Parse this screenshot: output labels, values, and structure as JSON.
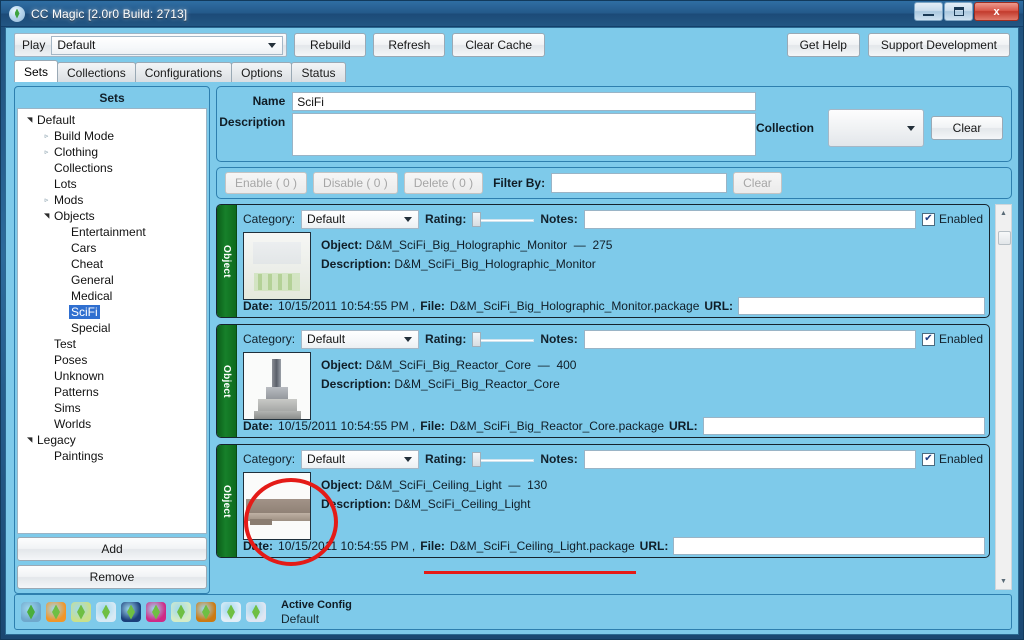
{
  "window": {
    "title": "CC Magic [2.0r0 Build: 2713]",
    "icon": "plumbob-icon",
    "minimize": "–",
    "maximize": "□",
    "close": "x"
  },
  "toolbar": {
    "play_label": "Play",
    "play_value": "Default",
    "rebuild": "Rebuild",
    "refresh": "Refresh",
    "clear_cache": "Clear Cache",
    "get_help": "Get Help",
    "support": "Support Development"
  },
  "tabs": [
    {
      "label": "Sets",
      "active": true
    },
    {
      "label": "Collections",
      "active": false
    },
    {
      "label": "Configurations",
      "active": false
    },
    {
      "label": "Options",
      "active": false
    },
    {
      "label": "Status",
      "active": false
    }
  ],
  "sidebar": {
    "header": "Sets",
    "add_label": "Add",
    "remove_label": "Remove",
    "tree": [
      {
        "label": "Default",
        "indent": 0,
        "expander": "open",
        "selected": false
      },
      {
        "label": "Build Mode",
        "indent": 1,
        "expander": "closed",
        "selected": false
      },
      {
        "label": "Clothing",
        "indent": 1,
        "expander": "closed",
        "selected": false
      },
      {
        "label": "Collections",
        "indent": 1,
        "expander": "none",
        "selected": false
      },
      {
        "label": "Lots",
        "indent": 1,
        "expander": "none",
        "selected": false
      },
      {
        "label": "Mods",
        "indent": 1,
        "expander": "closed",
        "selected": false
      },
      {
        "label": "Objects",
        "indent": 1,
        "expander": "open",
        "selected": false
      },
      {
        "label": "Entertainment",
        "indent": 2,
        "expander": "none",
        "selected": false
      },
      {
        "label": "Cars",
        "indent": 2,
        "expander": "none",
        "selected": false
      },
      {
        "label": "Cheat",
        "indent": 2,
        "expander": "none",
        "selected": false
      },
      {
        "label": "General",
        "indent": 2,
        "expander": "none",
        "selected": false
      },
      {
        "label": "Medical",
        "indent": 2,
        "expander": "none",
        "selected": false
      },
      {
        "label": "SciFi",
        "indent": 2,
        "expander": "none",
        "selected": true
      },
      {
        "label": "Special",
        "indent": 2,
        "expander": "none",
        "selected": false
      },
      {
        "label": "Test",
        "indent": 1,
        "expander": "none",
        "selected": false
      },
      {
        "label": "Poses",
        "indent": 1,
        "expander": "none",
        "selected": false
      },
      {
        "label": "Unknown",
        "indent": 1,
        "expander": "none",
        "selected": false
      },
      {
        "label": "Patterns",
        "indent": 1,
        "expander": "none",
        "selected": false
      },
      {
        "label": "Sims",
        "indent": 1,
        "expander": "none",
        "selected": false
      },
      {
        "label": "Worlds",
        "indent": 1,
        "expander": "none",
        "selected": false
      },
      {
        "label": "Legacy",
        "indent": 0,
        "expander": "open",
        "selected": false
      },
      {
        "label": "Paintings",
        "indent": 1,
        "expander": "none",
        "selected": false
      }
    ]
  },
  "meta": {
    "name_label": "Name",
    "name_value": "SciFi",
    "description_label": "Description",
    "description_value": "",
    "collection_label": "Collection",
    "collection_value": "",
    "clear_label": "Clear"
  },
  "actions": {
    "enable": "Enable ( 0 )",
    "disable": "Disable ( 0 )",
    "delete": "Delete ( 0 )",
    "filter_label": "Filter By:",
    "filter_value": "",
    "clear": "Clear"
  },
  "cards": [
    {
      "tab_label": "Object",
      "category_label": "Category:",
      "category_value": "Default",
      "rating_label": "Rating:",
      "rating_value": 0,
      "notes_label": "Notes:",
      "notes_value": "",
      "enabled_label": "Enabled",
      "enabled": true,
      "object_label": "Object:",
      "object_name": "D&M_SciFi_Big_Holographic_Monitor",
      "object_size": "275",
      "description_label": "Description:",
      "description_value": "D&M_SciFi_Big_Holographic_Monitor",
      "date_label": "Date:",
      "date_value": "10/15/2011 10:54:55 PM ,",
      "file_label": "File:",
      "file_value": "D&M_SciFi_Big_Holographic_Monitor.package",
      "url_label": "URL:",
      "url_value": "",
      "thumb": "holographic-monitor-thumbnail"
    },
    {
      "tab_label": "Object",
      "category_label": "Category:",
      "category_value": "Default",
      "rating_label": "Rating:",
      "rating_value": 0,
      "notes_label": "Notes:",
      "notes_value": "",
      "enabled_label": "Enabled",
      "enabled": true,
      "object_label": "Object:",
      "object_name": "D&M_SciFi_Big_Reactor_Core",
      "object_size": "400",
      "description_label": "Description:",
      "description_value": "D&M_SciFi_Big_Reactor_Core",
      "date_label": "Date:",
      "date_value": "10/15/2011 10:54:55 PM ,",
      "file_label": "File:",
      "file_value": "D&M_SciFi_Big_Reactor_Core.package",
      "url_label": "URL:",
      "url_value": "",
      "thumb": "reactor-core-thumbnail"
    },
    {
      "tab_label": "Object",
      "category_label": "Category:",
      "category_value": "Default",
      "rating_label": "Rating:",
      "rating_value": 0,
      "notes_label": "Notes:",
      "notes_value": "",
      "enabled_label": "Enabled",
      "enabled": true,
      "object_label": "Object:",
      "object_name": "D&M_SciFi_Ceiling_Light",
      "object_size": "130",
      "description_label": "Description:",
      "description_value": "D&M_SciFi_Ceiling_Light",
      "date_label": "Date:",
      "date_value": "10/15/2011 10:54:55 PM ,",
      "file_label": "File:",
      "file_value": "D&M_SciFi_Ceiling_Light.package",
      "url_label": "URL:",
      "url_value": "",
      "thumb": "ceiling-light-thumbnail"
    }
  ],
  "statusbar": {
    "active_config_label": "Active Config",
    "active_config_value": "Default",
    "icons": [
      {
        "name": "plumbob-icon-base-game",
        "bg": "#6fa8cc",
        "gem": "#4bae3c"
      },
      {
        "name": "plumbob-icon-world-adv",
        "bg": "#f0962a",
        "gem": "#6fbf43"
      },
      {
        "name": "plumbob-icon-hi-end-loft",
        "bg": "#c9e08a",
        "gem": "#6fbf43"
      },
      {
        "name": "plumbob-icon-ambitions",
        "bg": "#d7e9f4",
        "gem": "#6fbf43"
      },
      {
        "name": "plumbob-icon-fast-lane",
        "bg": "#1b3f7a",
        "gem": "#6fbf43"
      },
      {
        "name": "plumbob-icon-late-night",
        "bg": "#cf2a86",
        "gem": "#6fbf43"
      },
      {
        "name": "plumbob-icon-outdoor",
        "bg": "#d5ecc6",
        "gem": "#6fbf43"
      },
      {
        "name": "plumbob-icon-generations",
        "bg": "#cc7a12",
        "gem": "#6fbf43"
      },
      {
        "name": "plumbob-icon-town-life",
        "bg": "#e3eef7",
        "gem": "#6fbf43"
      },
      {
        "name": "plumbob-icon-pets",
        "bg": "#dfe6f2",
        "gem": "#6fbf43"
      }
    ]
  },
  "scrollbar": {
    "up": "▲",
    "down": "▼"
  },
  "annotations": {
    "circle": "red-highlight-circle-around-ceiling-light-thumbnail",
    "underline": "red-underline-under-ceiling-light-package-filename"
  },
  "colors": {
    "accent": "#7ecaea",
    "card_tab": "#17802a",
    "selection": "#2f6fd0",
    "annotation": "#e41b17"
  }
}
